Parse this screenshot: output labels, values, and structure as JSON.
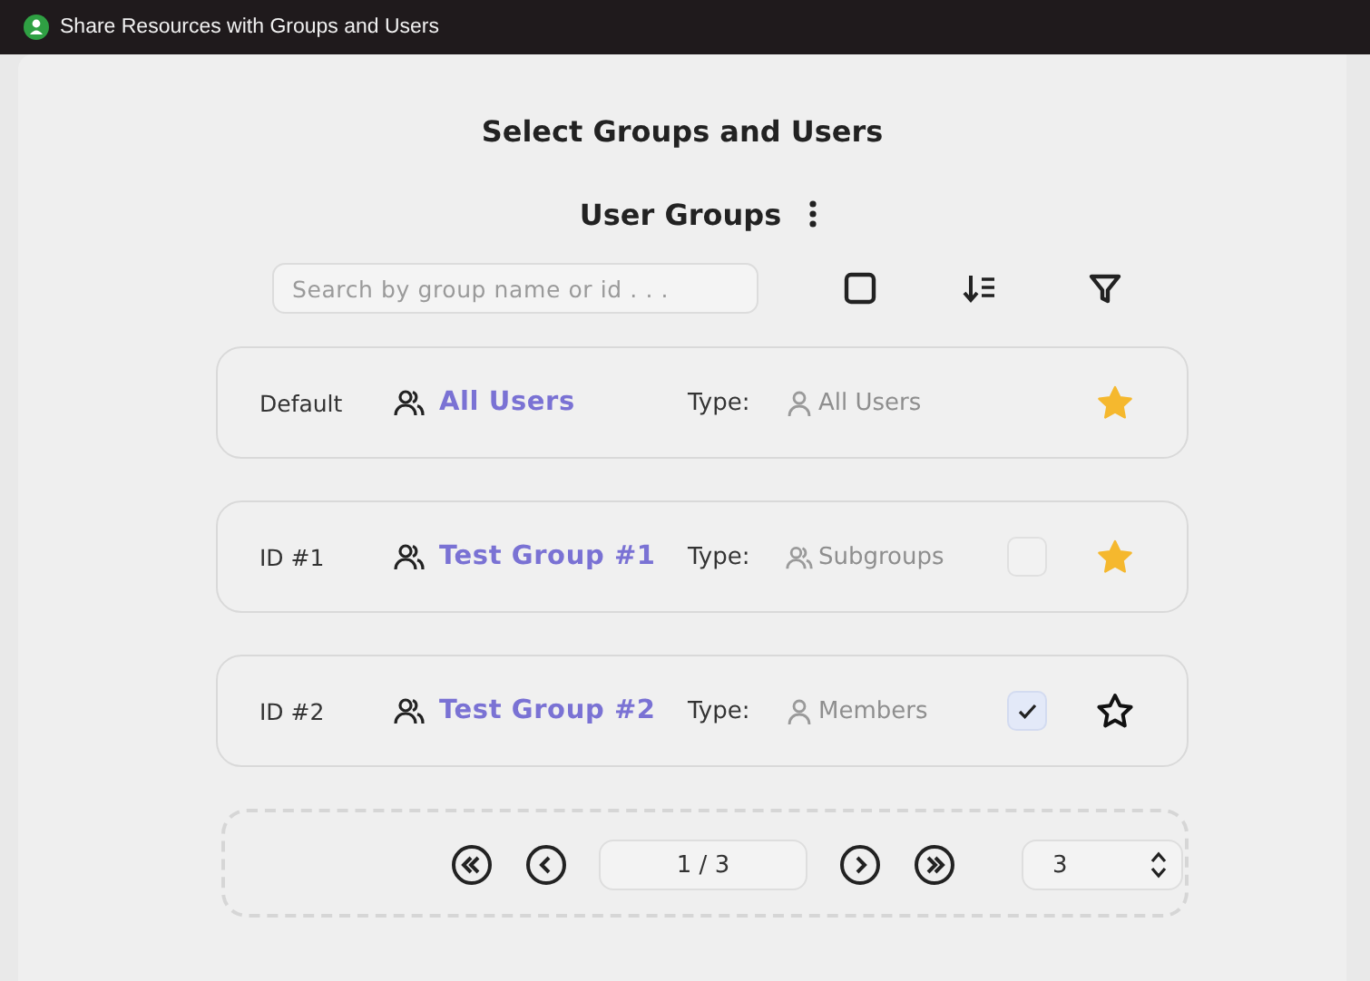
{
  "window": {
    "title": "Share Resources with Groups and Users"
  },
  "heading": "Select Groups and Users",
  "section": {
    "title": "User Groups"
  },
  "toolbar": {
    "search": {
      "placeholder": "Search by group name or id . . ."
    },
    "select_all": {
      "checked": false
    }
  },
  "groups": [
    {
      "kind": "default",
      "id_label": "Default",
      "name": "All Users",
      "type_label": "Type:",
      "type": {
        "kind": "person",
        "label": "All Users"
      },
      "favorite": true
    },
    {
      "kind": "group",
      "id_label": "ID #1",
      "name": "Test Group #1",
      "type_label": "Type:",
      "type": {
        "kind": "group",
        "label": "Subgroups"
      },
      "checked": false,
      "favorite": true
    },
    {
      "kind": "group",
      "id_label": "ID #2",
      "name": "Test Group #2",
      "type_label": "Type:",
      "type": {
        "kind": "person",
        "label": "Members"
      },
      "checked": true,
      "favorite": false
    }
  ],
  "pagination": {
    "page": "1 / 3",
    "page_size": "3"
  }
}
